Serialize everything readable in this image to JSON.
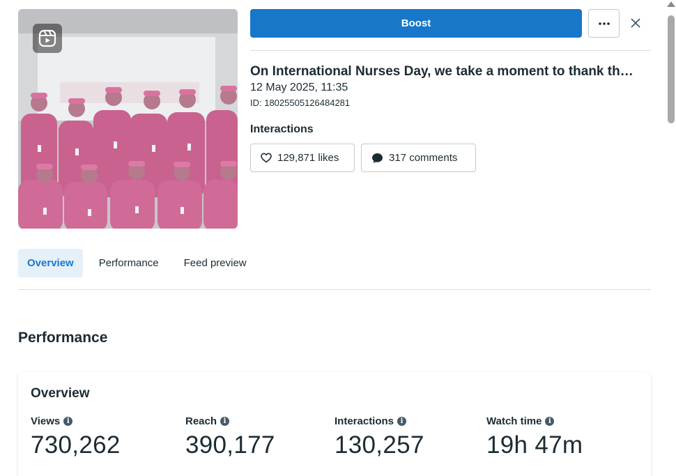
{
  "post": {
    "title": "On International Nurses Day, we take a moment to thank th…",
    "date": "12 May 2025, 11:35",
    "id": "ID: 18025505126484281",
    "thumbnail_icon": "reel-icon"
  },
  "actions": {
    "boost_label": "Boost",
    "more_icon": "ellipsis-icon",
    "close_icon": "close-icon"
  },
  "interactions": {
    "label": "Interactions",
    "likes": "129,871 likes",
    "comments": "317 comments"
  },
  "tabs": [
    {
      "label": "Overview",
      "active": true
    },
    {
      "label": "Performance",
      "active": false
    },
    {
      "label": "Feed preview",
      "active": false
    }
  ],
  "performance": {
    "section_title": "Performance",
    "card_title": "Overview",
    "metrics": [
      {
        "label": "Views",
        "value": "730,262"
      },
      {
        "label": "Reach",
        "value": "390,177"
      },
      {
        "label": "Interactions",
        "value": "130,257"
      },
      {
        "label": "Watch time",
        "value": "19h 47m"
      }
    ]
  },
  "colors": {
    "accent": "#1877c9",
    "tab_active_bg": "#e6f0f9",
    "scrub_pink": "#c9628f"
  }
}
